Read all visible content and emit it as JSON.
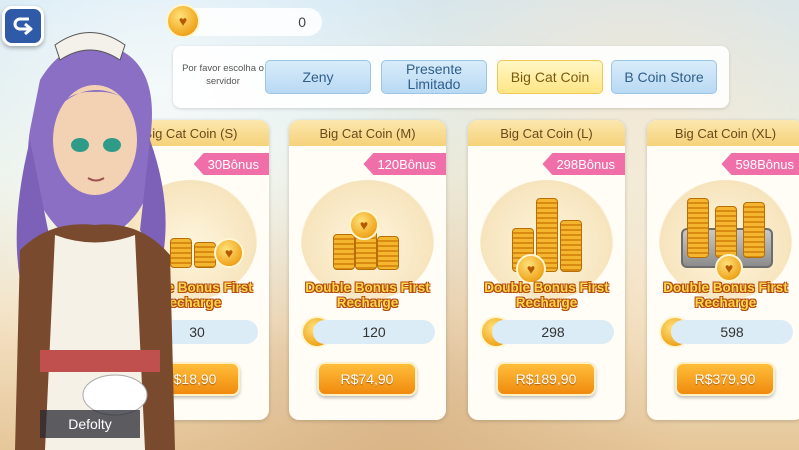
{
  "header": {
    "currency_value": "0",
    "back_icon": "back-arrow-icon"
  },
  "tabs_panel": {
    "server_label": "Por favor escolha o servidor",
    "tabs": [
      {
        "label": "Zeny",
        "active": false
      },
      {
        "label": "Presente Limitado",
        "active": false
      },
      {
        "label": "Big Cat Coin",
        "active": true
      },
      {
        "label": "B Coin Store",
        "active": false
      }
    ]
  },
  "cards": [
    {
      "title": "Big Cat Coin (S)",
      "bonus": "30Bônus",
      "promo": "Double Bonus First Recharge",
      "amount": "30",
      "price": "R$18,90"
    },
    {
      "title": "Big Cat Coin (M)",
      "bonus": "120Bônus",
      "promo": "Double Bonus First Recharge",
      "amount": "120",
      "price": "R$74,90"
    },
    {
      "title": "Big Cat Coin (L)",
      "bonus": "298Bônus",
      "promo": "Double Bonus First Recharge",
      "amount": "298",
      "price": "R$189,90"
    },
    {
      "title": "Big Cat Coin (XL)",
      "bonus": "598Bônus",
      "promo": "Double Bonus First Recharge",
      "amount": "598",
      "price": "R$379,90"
    }
  ],
  "character": {
    "name": "Defolty"
  },
  "colors": {
    "accent_orange": "#f08a0e",
    "bonus_pink": "#f06fa8",
    "active_tab": "#ffe586"
  }
}
